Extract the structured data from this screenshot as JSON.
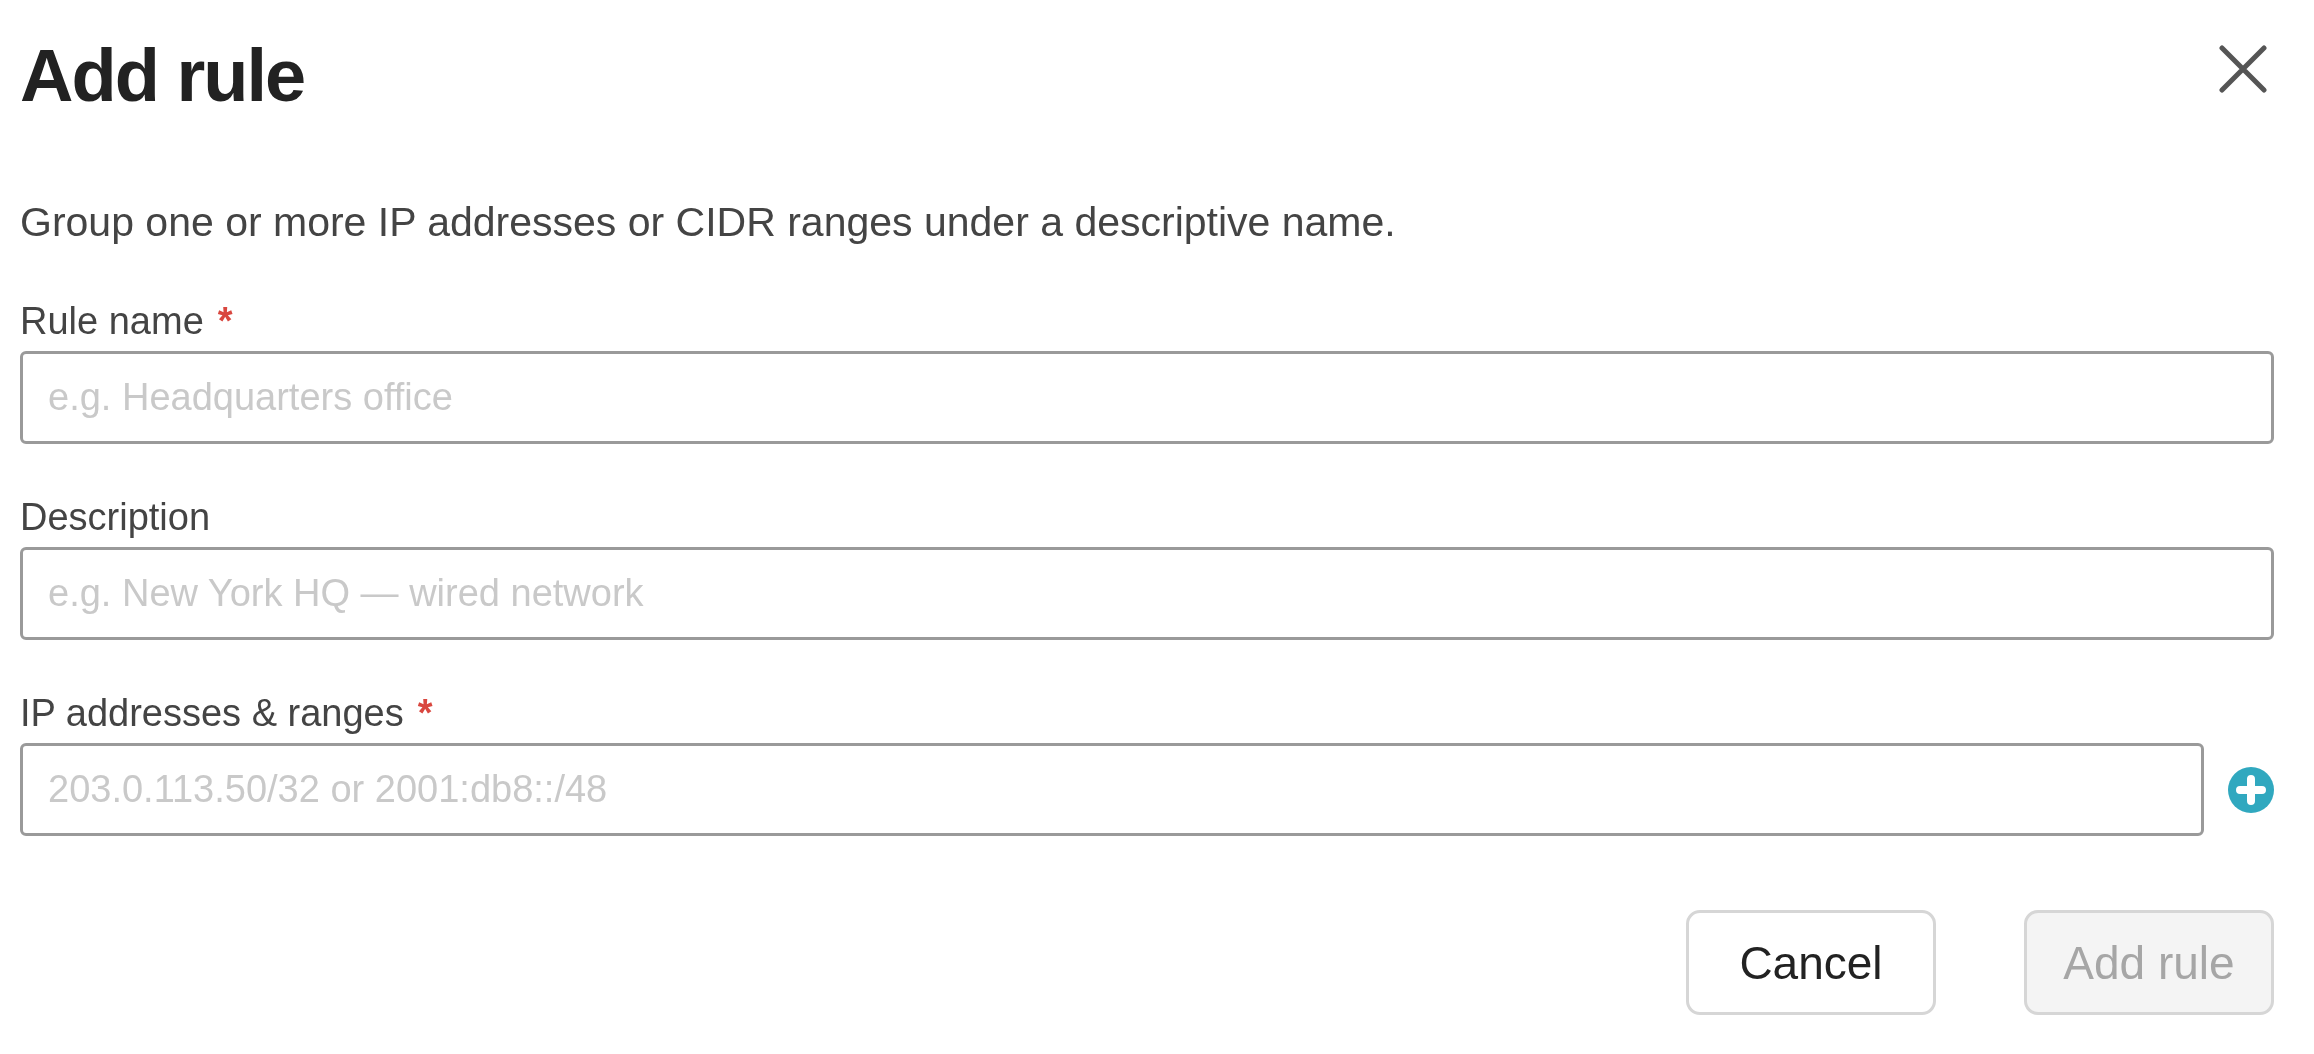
{
  "dialog": {
    "title": "Add rule",
    "description": "Group one or more IP addresses or CIDR ranges under a descriptive name."
  },
  "fields": [
    {
      "kind": "text",
      "label": "Rule name",
      "required_mark": "*",
      "placeholder": "e.g. Headquarters office"
    },
    {
      "kind": "text",
      "label": "Description",
      "placeholder": "e.g. New York HQ — wired network"
    },
    {
      "kind": "list",
      "label": "IP addresses & ranges",
      "required_mark": "*",
      "placeholder": "203.0.113.50/32 or 2001:db8::/48"
    }
  ],
  "buttons": [
    {
      "label": "Cancel",
      "disabled": false
    },
    {
      "label": "Add rule",
      "disabled": true
    }
  ]
}
